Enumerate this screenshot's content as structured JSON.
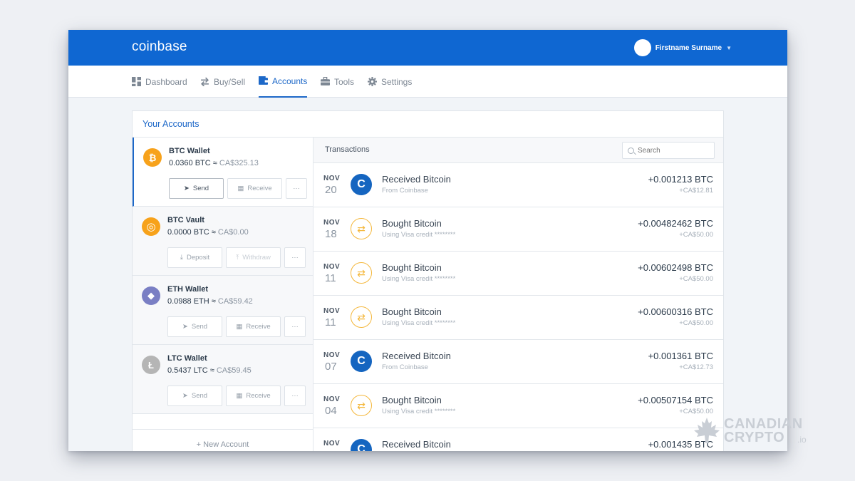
{
  "app": {
    "logo": "coinbase",
    "user_name": "Firstname Surname"
  },
  "nav": [
    {
      "label": "Dashboard",
      "icon": "dashboard-icon",
      "active": false
    },
    {
      "label": "Buy/Sell",
      "icon": "swap-icon",
      "active": false
    },
    {
      "label": "Accounts",
      "icon": "wallet-icon",
      "active": true
    },
    {
      "label": "Tools",
      "icon": "briefcase-icon",
      "active": false
    },
    {
      "label": "Settings",
      "icon": "gear-icon",
      "active": false
    }
  ],
  "accounts_title": "Your Accounts",
  "accounts": [
    {
      "name": "BTC Wallet",
      "amount": "0.0360 BTC",
      "approx": "≈",
      "fiat": "CA$325.13",
      "btn1": "Send",
      "btn2": "Receive",
      "more": "···",
      "color": "#f7a21b",
      "glyph": "₿"
    },
    {
      "name": "BTC Vault",
      "amount": "0.0000 BTC",
      "approx": "≈",
      "fiat": "CA$0.00",
      "btn1": "Deposit",
      "btn2": "Withdraw",
      "more": "···",
      "color": "#f7a21b",
      "glyph": "◎"
    },
    {
      "name": "ETH Wallet",
      "amount": "0.0988 ETH",
      "approx": "≈",
      "fiat": "CA$59.42",
      "btn1": "Send",
      "btn2": "Receive",
      "more": "···",
      "color": "#7a7fc4",
      "glyph": "◆"
    },
    {
      "name": "LTC Wallet",
      "amount": "0.5437 LTC",
      "approx": "≈",
      "fiat": "CA$59.45",
      "btn1": "Send",
      "btn2": "Receive",
      "more": "···",
      "color": "#b5b5b5",
      "glyph": "Ł"
    }
  ],
  "new_account": "+ New Account",
  "transactions_title": "Transactions",
  "search_placeholder": "Search",
  "transactions": [
    {
      "month": "NOV",
      "day": "20",
      "type": "coinbase",
      "title": "Received Bitcoin",
      "sub": "From Coinbase",
      "amount": "+0.001213 BTC",
      "fiat": "+CA$12.81"
    },
    {
      "month": "NOV",
      "day": "18",
      "type": "buy",
      "title": "Bought Bitcoin",
      "sub": "Using Visa credit ********",
      "amount": "+0.00482462 BTC",
      "fiat": "+CA$50.00"
    },
    {
      "month": "NOV",
      "day": "11",
      "type": "buy",
      "title": "Bought Bitcoin",
      "sub": "Using Visa credit ********",
      "amount": "+0.00602498 BTC",
      "fiat": "+CA$50.00"
    },
    {
      "month": "NOV",
      "day": "11",
      "type": "buy",
      "title": "Bought Bitcoin",
      "sub": "Using Visa credit ********",
      "amount": "+0.00600316 BTC",
      "fiat": "+CA$50.00"
    },
    {
      "month": "NOV",
      "day": "07",
      "type": "coinbase",
      "title": "Received Bitcoin",
      "sub": "From Coinbase",
      "amount": "+0.001361 BTC",
      "fiat": "+CA$12.73"
    },
    {
      "month": "NOV",
      "day": "04",
      "type": "buy",
      "title": "Bought Bitcoin",
      "sub": "Using Visa credit ********",
      "amount": "+0.00507154 BTC",
      "fiat": "+CA$50.00"
    },
    {
      "month": "NOV",
      "day": "",
      "type": "coinbase",
      "title": "Received Bitcoin",
      "sub": "",
      "amount": "+0.001435 BTC",
      "fiat": ""
    }
  ],
  "watermark": {
    "line1": "CANADIAN",
    "line2": "CRYPTO",
    "suffix": ".io"
  },
  "colors": {
    "brand": "#0f67d2",
    "accent": "#1d68c8",
    "bitcoin": "#f7a21b",
    "buy": "#f4b73b"
  }
}
